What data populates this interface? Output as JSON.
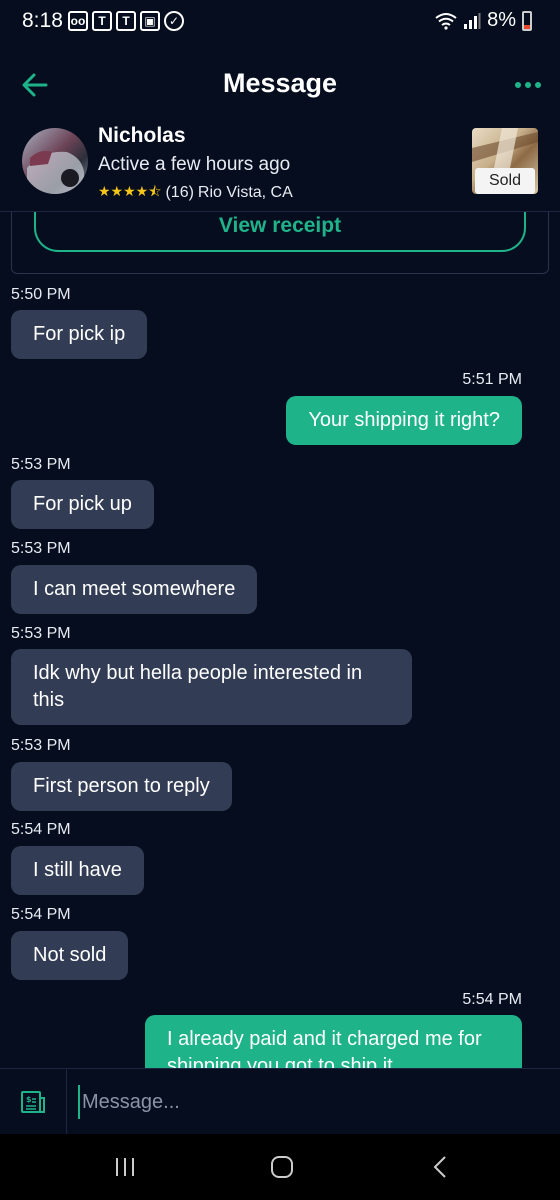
{
  "status_bar": {
    "time": "8:18",
    "battery": "8%"
  },
  "header": {
    "title": "Message"
  },
  "seller": {
    "name": "Nicholas",
    "status": "Active a few hours ago",
    "stars": "★★★★⯪",
    "reviews": "(16)",
    "location": "Rio Vista, CA",
    "item_badge": "Sold"
  },
  "receipt": {
    "button_label": "View receipt"
  },
  "messages": [
    {
      "time": "5:50 PM",
      "text": "For pick ip",
      "dir": "in"
    },
    {
      "time": "5:51 PM",
      "text": "Your shipping it right?",
      "dir": "out"
    },
    {
      "time": "5:53 PM",
      "text": "For pick up",
      "dir": "in"
    },
    {
      "time": "5:53 PM",
      "text": "I can meet somewhere",
      "dir": "in"
    },
    {
      "time": "5:53 PM",
      "text": "Idk why but hella people interested in this",
      "dir": "in"
    },
    {
      "time": "5:53 PM",
      "text": "First person to reply",
      "dir": "in"
    },
    {
      "time": "5:54 PM",
      "text": "I still have",
      "dir": "in"
    },
    {
      "time": "5:54 PM",
      "text": "Not sold",
      "dir": "in"
    },
    {
      "time": "5:54 PM",
      "text": "I already paid and it charged me for shipping you got to ship it",
      "dir": "out"
    }
  ],
  "composer": {
    "placeholder": "Message..."
  },
  "colors": {
    "accent": "#1fb38a",
    "background": "#050d1e",
    "incoming_bubble": "#323d55",
    "star": "#f5c518"
  }
}
